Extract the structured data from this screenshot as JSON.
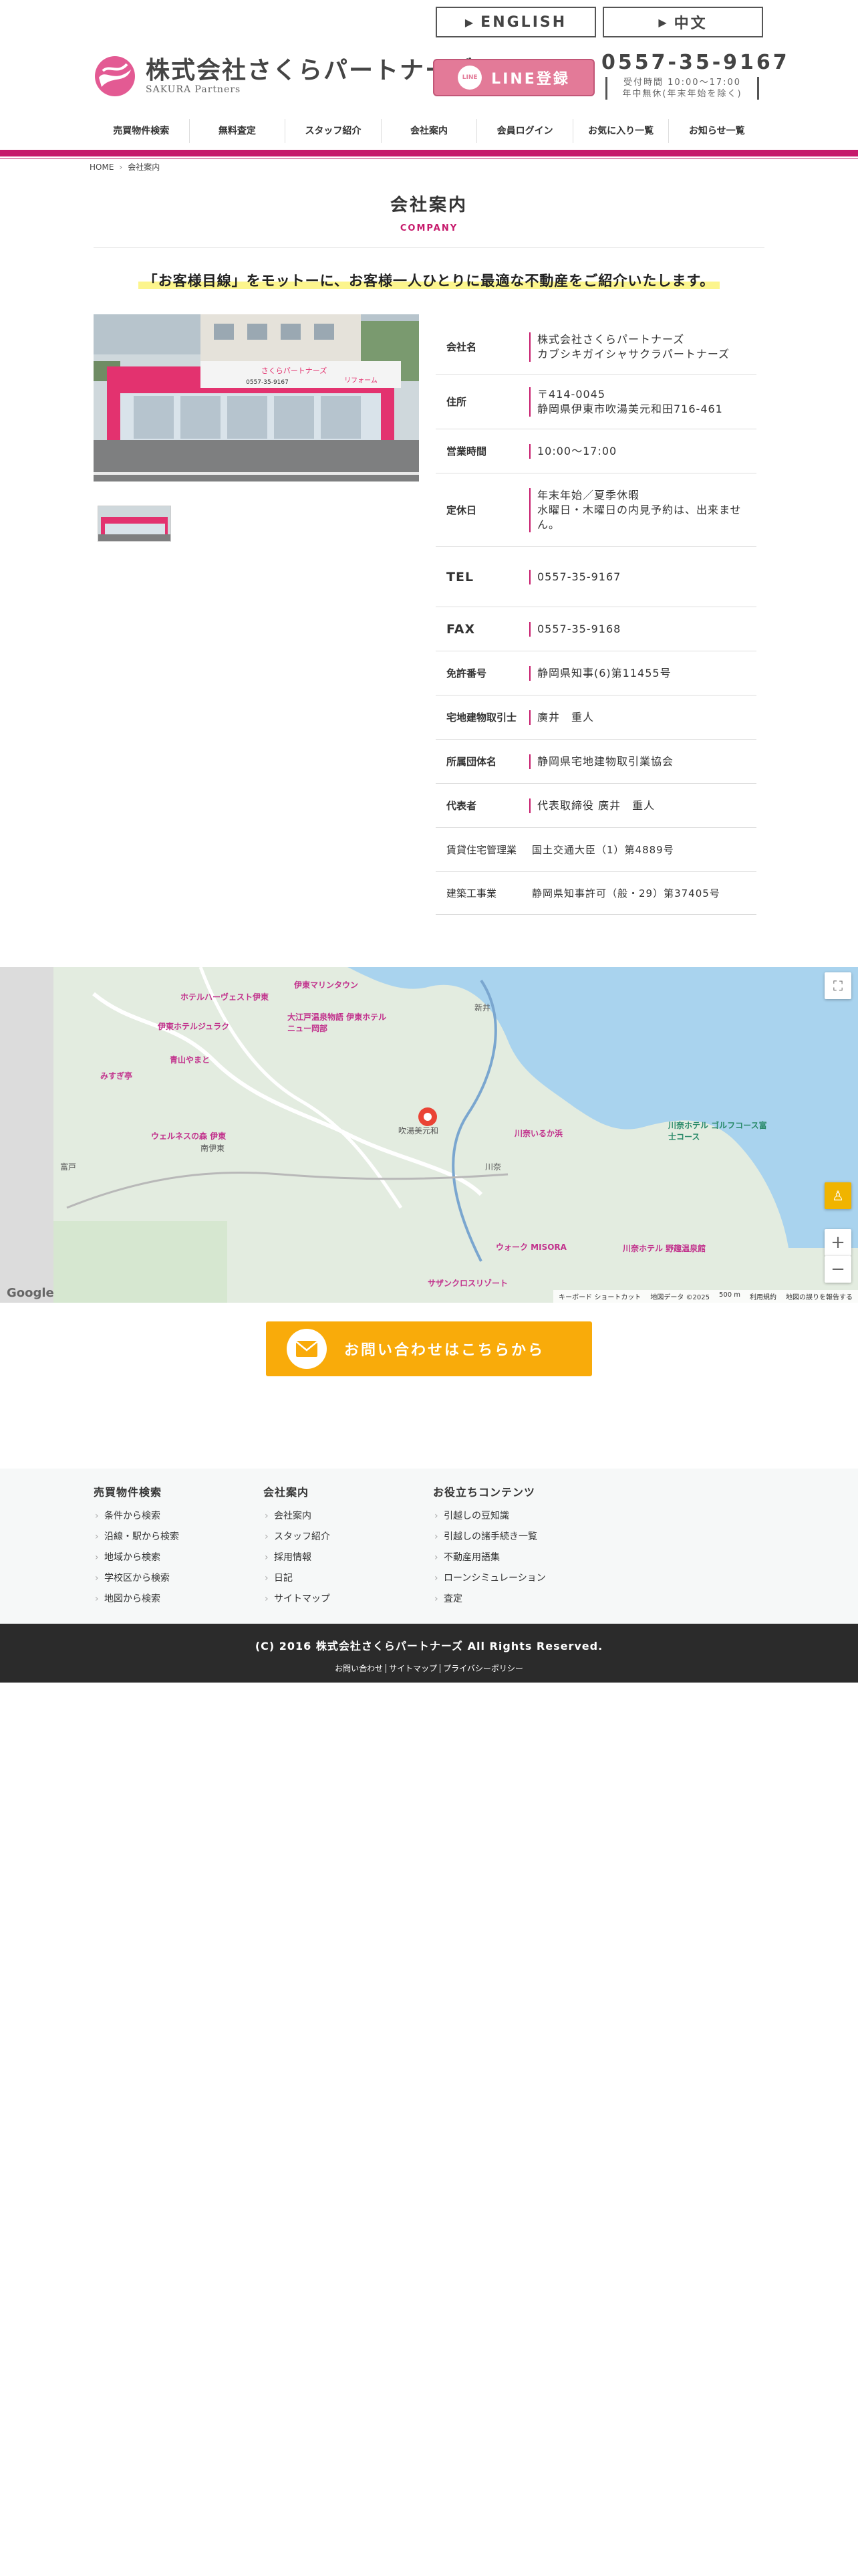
{
  "header": {
    "lang_buttons": [
      {
        "label": "ENGLISH"
      },
      {
        "label": "中文"
      }
    ],
    "logo_jp": "株式会社さくらパートナーズ",
    "logo_en": "SAKURA Partners",
    "line_badge": "LINE",
    "line_label": "LINE登録",
    "tel": "0557-35-9167",
    "hours": "受付時間 10:00〜17:00",
    "holiday": "年中無休(年末年始を除く)"
  },
  "nav": [
    "売買物件検索",
    "無料査定",
    "スタッフ紹介",
    "会社案内",
    "会員ログイン",
    "お気に入り一覧",
    "お知らせ一覧"
  ],
  "breadcrumb": {
    "home": "HOME",
    "current": "会社案内"
  },
  "page": {
    "title": "会社案内",
    "subtitle": "COMPANY",
    "motto": "「お客様目線」をモットーに、お客様一人ひとりに最適な不動産をご紹介いたします。"
  },
  "shop_sign": {
    "main": "さくらパートナーズ",
    "sub": "リフォーム",
    "tel": "0557-35-9167"
  },
  "company": [
    {
      "label": "会社名",
      "lines": [
        "株式会社さくらパートナーズ",
        "カブシキガイシャサクラパートナーズ"
      ],
      "h": 82
    },
    {
      "label": "住所",
      "lines": [
        "〒414-0045",
        "静岡県伊東市吹湯美元和田716-461"
      ],
      "h": 82
    },
    {
      "label": "営業時間",
      "lines": [
        "10:00〜17:00"
      ],
      "h": 66
    },
    {
      "label": "定休日",
      "lines": [
        "年末年始／夏季休暇",
        "水曜日・木曜日の内見予約は、出来ませ",
        "ん。"
      ],
      "h": 110
    },
    {
      "label": "TEL",
      "lines": [
        "0557-35-9167"
      ],
      "h": 90,
      "big": true
    },
    {
      "label": "FAX",
      "lines": [
        "0557-35-9168"
      ],
      "h": 66,
      "big": true
    },
    {
      "label": "免許番号",
      "lines": [
        "静岡県知事(6)第11455号"
      ],
      "h": 66
    },
    {
      "label": "宅地建物取引士",
      "lines": [
        "廣井　重人"
      ],
      "h": 66
    },
    {
      "label": "所属団体名",
      "lines": [
        "静岡県宅地建物取引業協会"
      ],
      "h": 66
    },
    {
      "label": "代表者",
      "lines": [
        "代表取締役 廣井　重人"
      ],
      "h": 66
    }
  ],
  "company_extra": [
    {
      "label": "賃貸住宅管理業",
      "value": "国土交通大臣（1）第4889号",
      "h": 66
    },
    {
      "label": "建築工事業",
      "value": "静岡県知事許可（般・29）第37405号",
      "h": 64
    }
  ],
  "map": {
    "places": [
      {
        "name": "ホテルハーヴェスト伊東",
        "cls": ""
      },
      {
        "name": "伊東ホテルジュラク",
        "cls": ""
      },
      {
        "name": "大江戸温泉物語 伊東ホテルニュー岡部",
        "cls": ""
      },
      {
        "name": "みすぎ亭",
        "cls": ""
      },
      {
        "name": "青山やまと",
        "cls": ""
      },
      {
        "name": "ウェルネスの森 伊東",
        "cls": ""
      },
      {
        "name": "川奈いるか浜",
        "cls": ""
      },
      {
        "name": "川奈ホテル ゴルフコース富士コース",
        "cls": "teal"
      },
      {
        "name": "ウォーク MISORA",
        "cls": ""
      },
      {
        "name": "川奈ホテル 野趣温泉館",
        "cls": ""
      },
      {
        "name": "サザンクロスリゾート",
        "cls": ""
      },
      {
        "name": "吹湯美元和",
        "cls": "dark"
      },
      {
        "name": "富戸",
        "cls": "dark"
      },
      {
        "name": "川奈",
        "cls": "dark"
      },
      {
        "name": "南伊東",
        "cls": "dark"
      },
      {
        "name": "新井",
        "cls": "dark"
      },
      {
        "name": "伊東マリンタウン",
        "cls": ""
      }
    ],
    "google": "Google",
    "footer": [
      "キーボード ショートカット",
      "地図データ ©2025",
      "500 m",
      "利用規約",
      "地図の誤りを報告する"
    ]
  },
  "cta": {
    "label": "お問い合わせはこちらから"
  },
  "footer_nav": [
    {
      "title": "売買物件検索",
      "items": [
        "条件から検索",
        "沿線・駅から検索",
        "地域から検索",
        "学校区から検索",
        "地図から検索"
      ]
    },
    {
      "title": "会社案内",
      "items": [
        "会社案内",
        "スタッフ紹介",
        "採用情報",
        "日記",
        "サイトマップ"
      ]
    },
    {
      "title": "お役立ちコンテンツ",
      "items": [
        "引越しの豆知識",
        "引越しの諸手続き一覧",
        "不動産用語集",
        "ローンシミュレーション",
        "査定"
      ]
    }
  ],
  "copyright": "(C) 2016 株式会社さくらパートナーズ All Rights Reserved.",
  "bottom_links": [
    "お問い合わせ",
    "サイトマップ",
    "プライバシーポリシー"
  ],
  "colors": {
    "accent": "#c6196b",
    "line_button": "#e37a98",
    "cta": "#f9ab0a"
  }
}
